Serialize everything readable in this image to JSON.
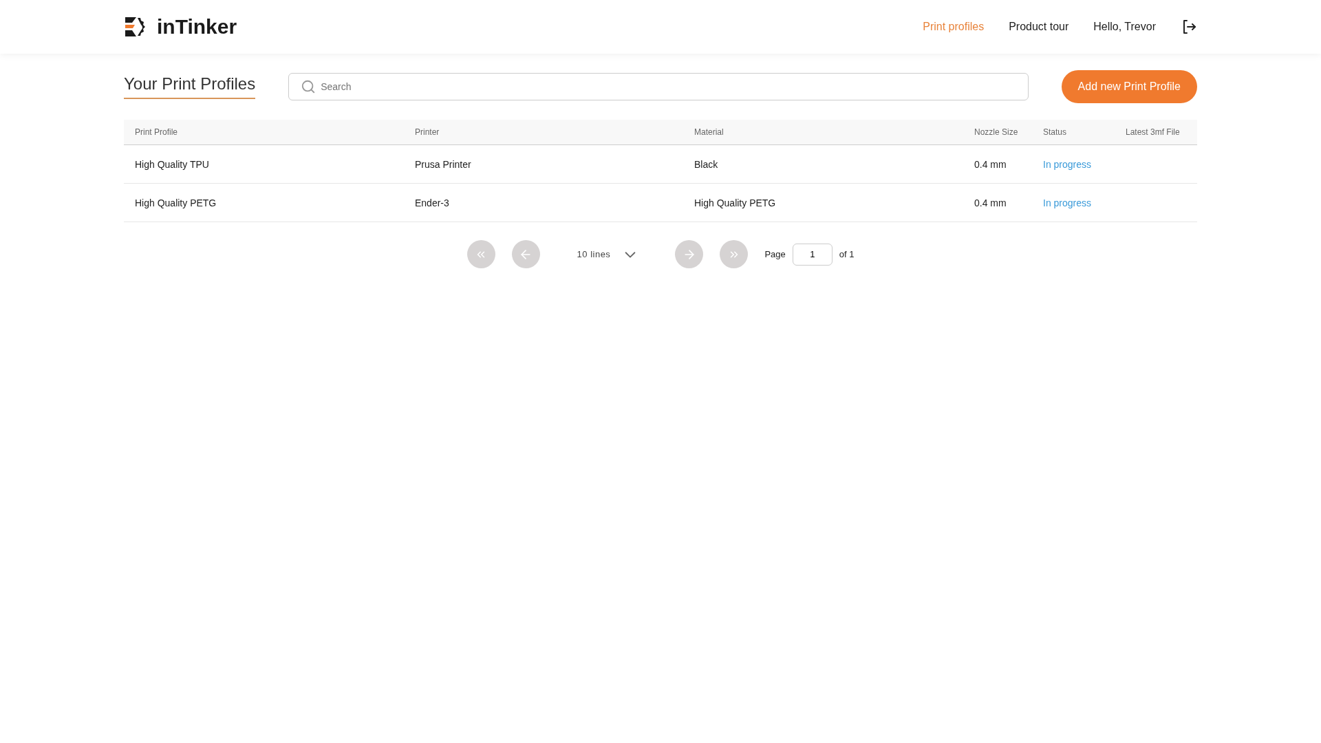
{
  "brand": {
    "name": "inTinker"
  },
  "nav": [
    {
      "label": "Print profiles",
      "selected": true
    },
    {
      "label": "Product tour",
      "selected": false
    }
  ],
  "user": {
    "greeting": "Hello, Trevor"
  },
  "page": {
    "title": "Your Print Profiles",
    "search": {
      "placeholder": "Search"
    },
    "add_button": "Add new Print Profile"
  },
  "table": {
    "columns": [
      "Print Profile",
      "Printer",
      "Material",
      "Nozzle Size",
      "Status",
      "Latest 3mf File"
    ],
    "rows": [
      {
        "cells": [
          "High Quality TPU",
          "Prusa Printer",
          "Black",
          "0.4 mm"
        ],
        "status": "In progress"
      },
      {
        "cells": [
          "High Quality PETG",
          "Ender-3",
          "High Quality PETG",
          "0.4 mm"
        ],
        "status": "In progress"
      }
    ]
  },
  "pagination": {
    "lines": "10 lines",
    "page_label": "Page",
    "page": "1",
    "of": "of 1"
  }
}
